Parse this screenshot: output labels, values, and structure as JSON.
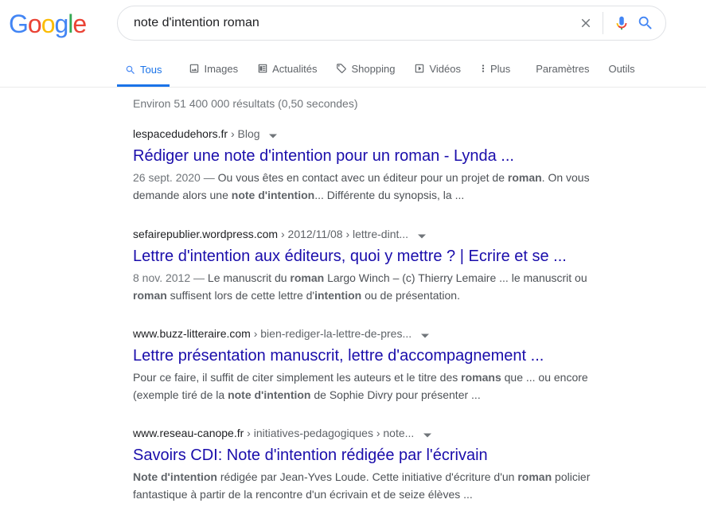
{
  "logo": {
    "letters": [
      "G",
      "o",
      "o",
      "g",
      "l",
      "e"
    ],
    "colors": [
      "#4285F4",
      "#EA4335",
      "#FBBC05",
      "#4285F4",
      "#34A853",
      "#EA4335"
    ]
  },
  "search": {
    "query": "note d'intention roman"
  },
  "icons": {
    "clear": "close-icon",
    "voice": "mic-icon",
    "search": "search-icon"
  },
  "tabs": [
    {
      "label": "Tous",
      "icon": "search-icon",
      "active": true
    },
    {
      "label": "Images",
      "icon": "image-icon"
    },
    {
      "label": "Actualités",
      "icon": "news-icon"
    },
    {
      "label": "Shopping",
      "icon": "tag-icon"
    },
    {
      "label": "Vidéos",
      "icon": "play-icon"
    },
    {
      "label": "Plus",
      "icon": "more-vert-icon"
    }
  ],
  "settings_label": "Paramètres",
  "tools_label": "Outils",
  "result_stats": "Environ 51 400 000 résultats (0,50 secondes)",
  "results": [
    {
      "domain": "lespacedudehors.fr",
      "crumbs": " › Blog",
      "title": "Rédiger une note d'intention pour un roman - Lynda ...",
      "snippet_parts": [
        {
          "t": "26 sept. 2020 — ",
          "cls": "date"
        },
        {
          "t": "Ou vous êtes en contact avec un éditeur pour un projet de "
        },
        {
          "t": "roman",
          "b": true
        },
        {
          "t": ". On vous demande alors une "
        },
        {
          "t": "note d'intention",
          "b": true
        },
        {
          "t": "... Différente du synopsis, la ..."
        }
      ]
    },
    {
      "domain": "sefairepublier.wordpress.com",
      "crumbs": " › 2012/11/08 › lettre-dint...",
      "title": "Lettre d'intention aux éditeurs, quoi y mettre ? | Ecrire et se ...",
      "snippet_parts": [
        {
          "t": "8 nov. 2012 — ",
          "cls": "date"
        },
        {
          "t": "Le manuscrit du "
        },
        {
          "t": "roman",
          "b": true
        },
        {
          "t": " Largo Winch – (c) Thierry Lemaire ... le manuscrit ou "
        },
        {
          "t": "roman",
          "b": true
        },
        {
          "t": " suffisent lors de cette lettre d'"
        },
        {
          "t": "intention",
          "b": true
        },
        {
          "t": " ou de présentation."
        }
      ]
    },
    {
      "domain": "www.buzz-litteraire.com",
      "crumbs": " › bien-rediger-la-lettre-de-pres...",
      "title": "Lettre présentation manuscrit, lettre d'accompagnement ...",
      "snippet_parts": [
        {
          "t": "Pour ce faire, il suffit de citer simplement les auteurs et le titre des "
        },
        {
          "t": "romans",
          "b": true
        },
        {
          "t": " que ... ou encore (exemple tiré de la "
        },
        {
          "t": "note d'intention",
          "b": true
        },
        {
          "t": " de Sophie Divry pour présenter ..."
        }
      ]
    },
    {
      "domain": "www.reseau-canope.fr",
      "crumbs": " › initiatives-pedagogiques › note...",
      "title": "Savoirs CDI: Note d'intention rédigée par l'écrivain",
      "snippet_parts": [
        {
          "t": "Note d'intention",
          "b": true
        },
        {
          "t": " rédigée par Jean-Yves Loude. Cette initiative d'écriture d'un "
        },
        {
          "t": "roman",
          "b": true
        },
        {
          "t": " policier fantastique à partir de la rencontre d'un écrivain et de seize élèves ..."
        }
      ]
    }
  ]
}
